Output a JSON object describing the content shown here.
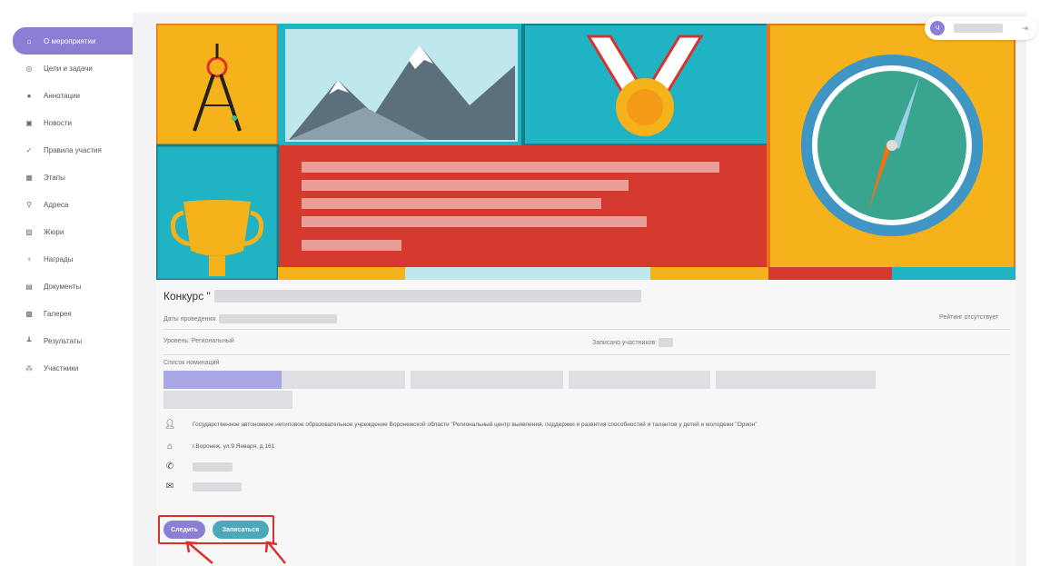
{
  "sidebar": {
    "items": [
      {
        "label": "О мероприятии",
        "icon": "home-icon",
        "glyph": "⌂",
        "active": true
      },
      {
        "label": "Цели и задачи",
        "icon": "target-icon",
        "glyph": "◎",
        "active": false
      },
      {
        "label": "Аннотации",
        "icon": "info-icon",
        "glyph": "●",
        "active": false
      },
      {
        "label": "Новости",
        "icon": "news-icon",
        "glyph": "▣",
        "active": false
      },
      {
        "label": "Правила участия",
        "icon": "check-icon",
        "glyph": "✓",
        "active": false
      },
      {
        "label": "Этапы",
        "icon": "stages-icon",
        "glyph": "▦",
        "active": false
      },
      {
        "label": "Адреса",
        "icon": "location-icon",
        "glyph": "⚲",
        "active": false
      },
      {
        "label": "Жюри",
        "icon": "jury-icon",
        "glyph": "▨",
        "active": false
      },
      {
        "label": "Награды",
        "icon": "trophy-icon",
        "glyph": "♆",
        "active": false
      },
      {
        "label": "Документы",
        "icon": "document-icon",
        "glyph": "▤",
        "active": false
      },
      {
        "label": "Галерея",
        "icon": "gallery-icon",
        "glyph": "▩",
        "active": false
      },
      {
        "label": "Результаты",
        "icon": "results-icon",
        "glyph": "┻",
        "active": false
      },
      {
        "label": "Участники",
        "icon": "participants-icon",
        "glyph": "⁂",
        "active": false
      }
    ]
  },
  "user": {
    "avatar_letter": "Ч"
  },
  "event": {
    "title_prefix": "Конкурс \"",
    "dates_label": "Даты проведения",
    "rating_text": "Рейтинг отсутствует",
    "level_text": "Уровень: Региональный",
    "registered_label": "Записано участников:",
    "nominations_label": "Список номинаций",
    "organization": "Государственное автономное нетиповое образовательное учреждение Воронежской области \"Региональный центр выявления, поддержки и развития способностей и талантов у детей и молодежи \"Орион\"",
    "address": "г.Воронеж, ул.9 Января, д.161"
  },
  "actions": {
    "follow_label": "Следить",
    "signup_label": "Записаться"
  },
  "colors": {
    "accent": "#8a7fd4",
    "signup": "#4aa8b8",
    "highlight": "#d93030",
    "banner_orange": "#f6a623",
    "banner_teal": "#1fb3c4",
    "banner_red": "#d63a2e"
  }
}
